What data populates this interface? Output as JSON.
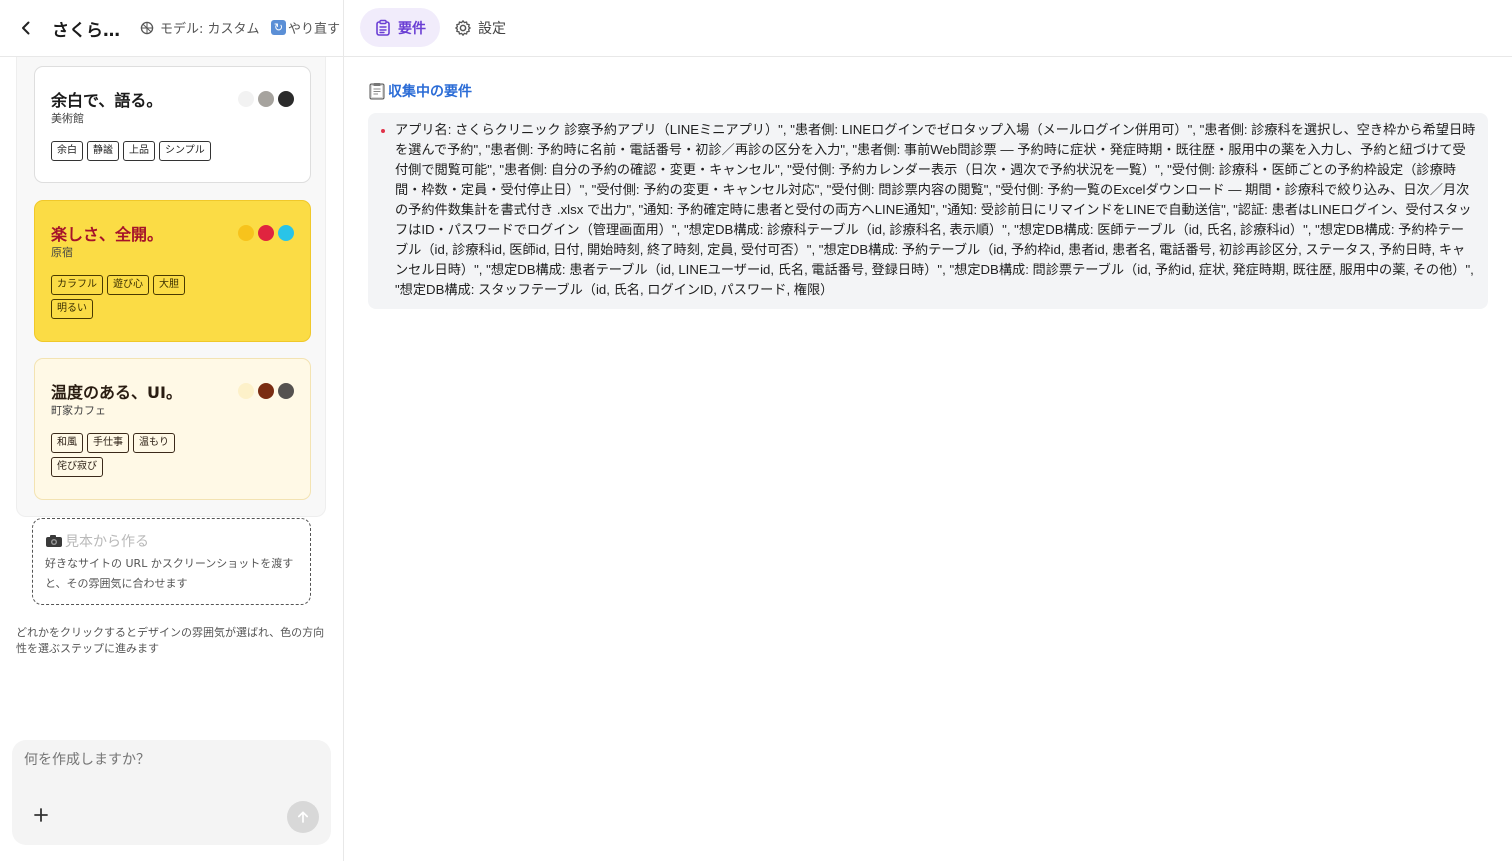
{
  "header": {
    "app_title": "さくら…",
    "model_label": "モデル: カスタム",
    "redo_label": "やり直す",
    "tabs": [
      {
        "label": "要件",
        "active": true
      },
      {
        "label": "設定",
        "active": false
      }
    ]
  },
  "style_cards": [
    {
      "title": "余白で、語る。",
      "subtitle": "美術館",
      "swatches": [
        "#f2f2f2",
        "#a6a39e",
        "#2b2b2b"
      ],
      "tags": [
        "余白",
        "静謐",
        "上品",
        "シンプル"
      ]
    },
    {
      "title": "楽しさ、全開。",
      "subtitle": "原宿",
      "swatches": [
        "#f7c31c",
        "#e0243f",
        "#29c4e8"
      ],
      "tags": [
        "カラフル",
        "遊び心",
        "大胆",
        "明るい"
      ]
    },
    {
      "title": "温度のある、UI。",
      "subtitle": "町家カフェ",
      "swatches": [
        "#fdf1c9",
        "#7a2d12",
        "#555250"
      ],
      "tags": [
        "和風",
        "手仕事",
        "温もり",
        "侘び寂び"
      ]
    }
  ],
  "sample": {
    "title": "見本から作る",
    "description": "好きなサイトの URL かスクリーンショットを渡すと、その雰囲気に合わせます"
  },
  "hint": "どれかをクリックするとデザインの雰囲気が選ばれ、色の方向性を選ぶステップに進みます",
  "composer": {
    "placeholder": "何を作成しますか？"
  },
  "requirements": {
    "section_title": "収集中の要件",
    "items": [
      "アプリ名: さくらクリニック 診察予約アプリ（LINEミニアプリ）\", \"患者側: LINEログインでゼロタップ入場（メールログイン併用可）\", \"患者側: 診療科を選択し、空き枠から希望日時を選んで予約\", \"患者側: 予約時に名前・電話番号・初診／再診の区分を入力\", \"患者側: 事前Web問診票 — 予約時に症状・発症時期・既往歴・服用中の薬を入力し、予約と紐づけて受付側で閲覧可能\", \"患者側: 自分の予約の確認・変更・キャンセル\", \"受付側: 予約カレンダー表示（日次・週次で予約状況を一覧）\", \"受付側: 診療科・医師ごとの予約枠設定（診療時間・枠数・定員・受付停止日）\", \"受付側: 予約の変更・キャンセル対応\", \"受付側: 問診票内容の閲覧\", \"受付側: 予約一覧のExcelダウンロード — 期間・診療科で絞り込み、日次／月次の予約件数集計を書式付き .xlsx で出力\", \"通知: 予約確定時に患者と受付の両方へLINE通知\", \"通知: 受診前日にリマインドをLINEで自動送信\", \"認証: 患者はLINEログイン、受付スタッフはID・パスワードでログイン（管理画面用）\", \"想定DB構成: 診療科テーブル（id, 診療科名, 表示順）\", \"想定DB構成: 医師テーブル（id, 氏名, 診療科id）\", \"想定DB構成: 予約枠テーブル（id, 診療科id, 医師id, 日付, 開始時刻, 終了時刻, 定員, 受付可否）\", \"想定DB構成: 予約テーブル（id, 予約枠id, 患者id, 患者名, 電話番号, 初診再診区分, ステータス, 予約日時, キャンセル日時）\", \"想定DB構成: 患者テーブル（id, LINEユーザーid, 氏名, 電話番号, 登録日時）\", \"想定DB構成: 問診票テーブル（id, 予約id, 症状, 発症時期, 既往歴, 服用中の薬, その他）\", \"想定DB構成: スタッフテーブル（id, 氏名, ログインID, パスワード, 権限）"
    ]
  }
}
